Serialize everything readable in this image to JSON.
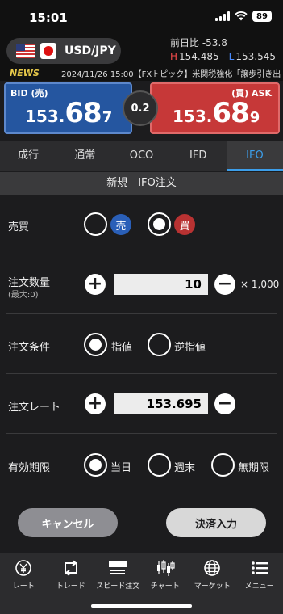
{
  "status_bar": {
    "time": "15:01",
    "battery": "89"
  },
  "header": {
    "pair": "USD/JPY",
    "day_change_label": "前日比",
    "day_change_value": "-53.8",
    "high_label": "H",
    "high_value": "154.485",
    "low_label": "L",
    "low_value": "153.545",
    "news_tag": "NEWS",
    "news_text": "2024/11/26 15:00【FXトピック】米関税強化「譲歩引き出"
  },
  "prices": {
    "bid_label": "BID (売)",
    "bid_small": "153.",
    "bid_big": "68",
    "bid_pip": "7",
    "ask_label": "(買) ASK",
    "ask_small": "153.",
    "ask_big": "68",
    "ask_pip": "9",
    "spread": "0.2"
  },
  "tabs": [
    "成行",
    "通常",
    "OCO",
    "IFD",
    "IFO"
  ],
  "active_tab": "IFO",
  "subtitle": "新規　IFO注文",
  "form": {
    "side_label": "売買",
    "sell_text": "売",
    "buy_text": "買",
    "selected_side": "買",
    "qty_label": "注文数量",
    "qty_sublabel": "(最大:0)",
    "qty_value": "10",
    "qty_unit": "× 1,000",
    "condition_label": "注文条件",
    "condition_options": [
      "指値",
      "逆指値"
    ],
    "condition_selected": "指値",
    "rate_label": "注文レート",
    "rate_value": "153.695",
    "expiry_label": "有効期限",
    "expiry_options": [
      "当日",
      "週末",
      "無期限"
    ],
    "expiry_selected": "当日"
  },
  "buttons": {
    "cancel": "キャンセル",
    "submit": "決済入力"
  },
  "nav": [
    {
      "label": "レート",
      "icon": "yen-coin-icon"
    },
    {
      "label": "トレード",
      "icon": "trade-arrows-icon"
    },
    {
      "label": "スピード注文",
      "icon": "speed-order-icon"
    },
    {
      "label": "チャート",
      "icon": "candlestick-chart-icon"
    },
    {
      "label": "マーケット",
      "icon": "globe-icon"
    },
    {
      "label": "メニュー",
      "icon": "menu-icon"
    }
  ],
  "colors": {
    "bid": "#2556a0",
    "ask": "#c63838",
    "accent": "#3c9eea",
    "news": "#e6c84a"
  }
}
